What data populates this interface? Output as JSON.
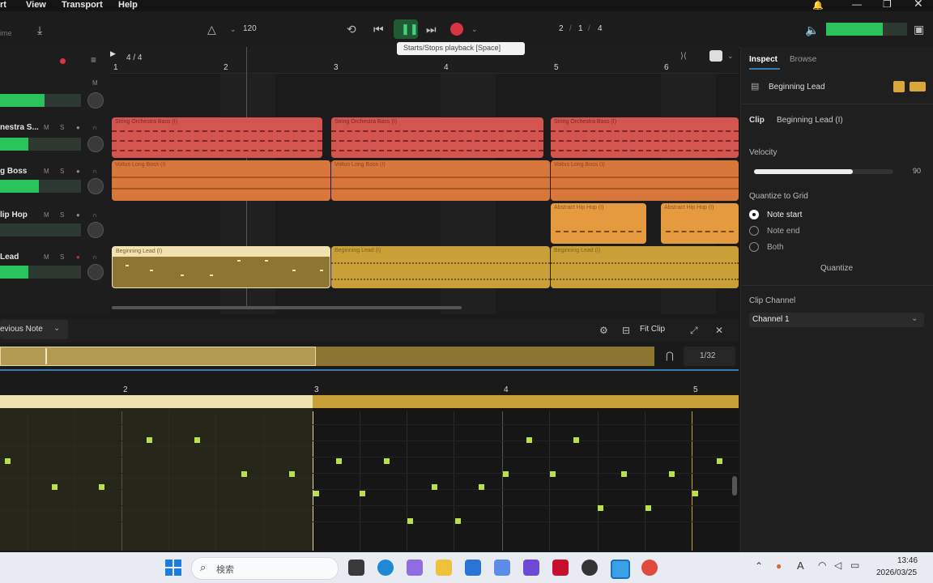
{
  "menu": {
    "items": [
      "rt",
      "View",
      "Transport",
      "Help"
    ]
  },
  "toolbar": {
    "left_label": "ime",
    "tempo": "120",
    "position": [
      "2",
      "1",
      "4"
    ],
    "tooltip": "Starts/Stops playback [Space]"
  },
  "timeline": {
    "time_signature": "4 / 4",
    "bars": [
      "1",
      "2",
      "3",
      "4",
      "5",
      "6"
    ]
  },
  "tracks": [
    {
      "name": "",
      "meter": 0.55
    },
    {
      "name": "nestra S...",
      "meter": 0.35
    },
    {
      "name": "g Boss",
      "meter": 0.48
    },
    {
      "name": "lip Hop",
      "meter": 0.0
    },
    {
      "name": "Lead",
      "meter": 0.35
    }
  ],
  "clips": {
    "strings": [
      "String Orchestra Bass (I)",
      "String Orchestra Bass (I)",
      "String Orchestra Bass (I)"
    ],
    "boss": [
      "Voltus Long Boss (I)",
      "Voltus Long Boss (I)",
      "Voltus Long Boss (I)"
    ],
    "hiphop": [
      "Abstract Hip Hop (I)",
      "Abstract Hip Hop (I)"
    ],
    "lead": [
      "Beginning Lead (I)",
      "Beginning Lead (I)",
      "Beginning Lead (I)"
    ]
  },
  "editor": {
    "mode": "evious Note",
    "fit_clip": "Fit Clip",
    "grid": "1/32",
    "bars": [
      "2",
      "3",
      "4",
      "5"
    ]
  },
  "inspector": {
    "tabs": [
      "Inspect",
      "Browse"
    ],
    "track_name": "Beginning Lead",
    "clip_label": "Clip",
    "clip_name": "Beginning Lead (I)",
    "velocity_label": "Velocity",
    "velocity_value": "90",
    "velocity": 0.78,
    "quantize_label": "Quantize to Grid",
    "options": [
      "Note start",
      "Note end",
      "Both"
    ],
    "quantize_button": "Quantize",
    "channel_label": "Clip Channel",
    "channel_value": "Channel 1"
  },
  "taskbar": {
    "search": "検索",
    "time": "13:46",
    "date": "2026/03/25"
  },
  "colors": {
    "strings": "#d4554f",
    "boss": "#d8773c",
    "hiphop": "#e59a40",
    "lead": "#c9a037",
    "lead_selected": "#8e7531",
    "meter": "#29c25b",
    "record": "#d9343f"
  }
}
